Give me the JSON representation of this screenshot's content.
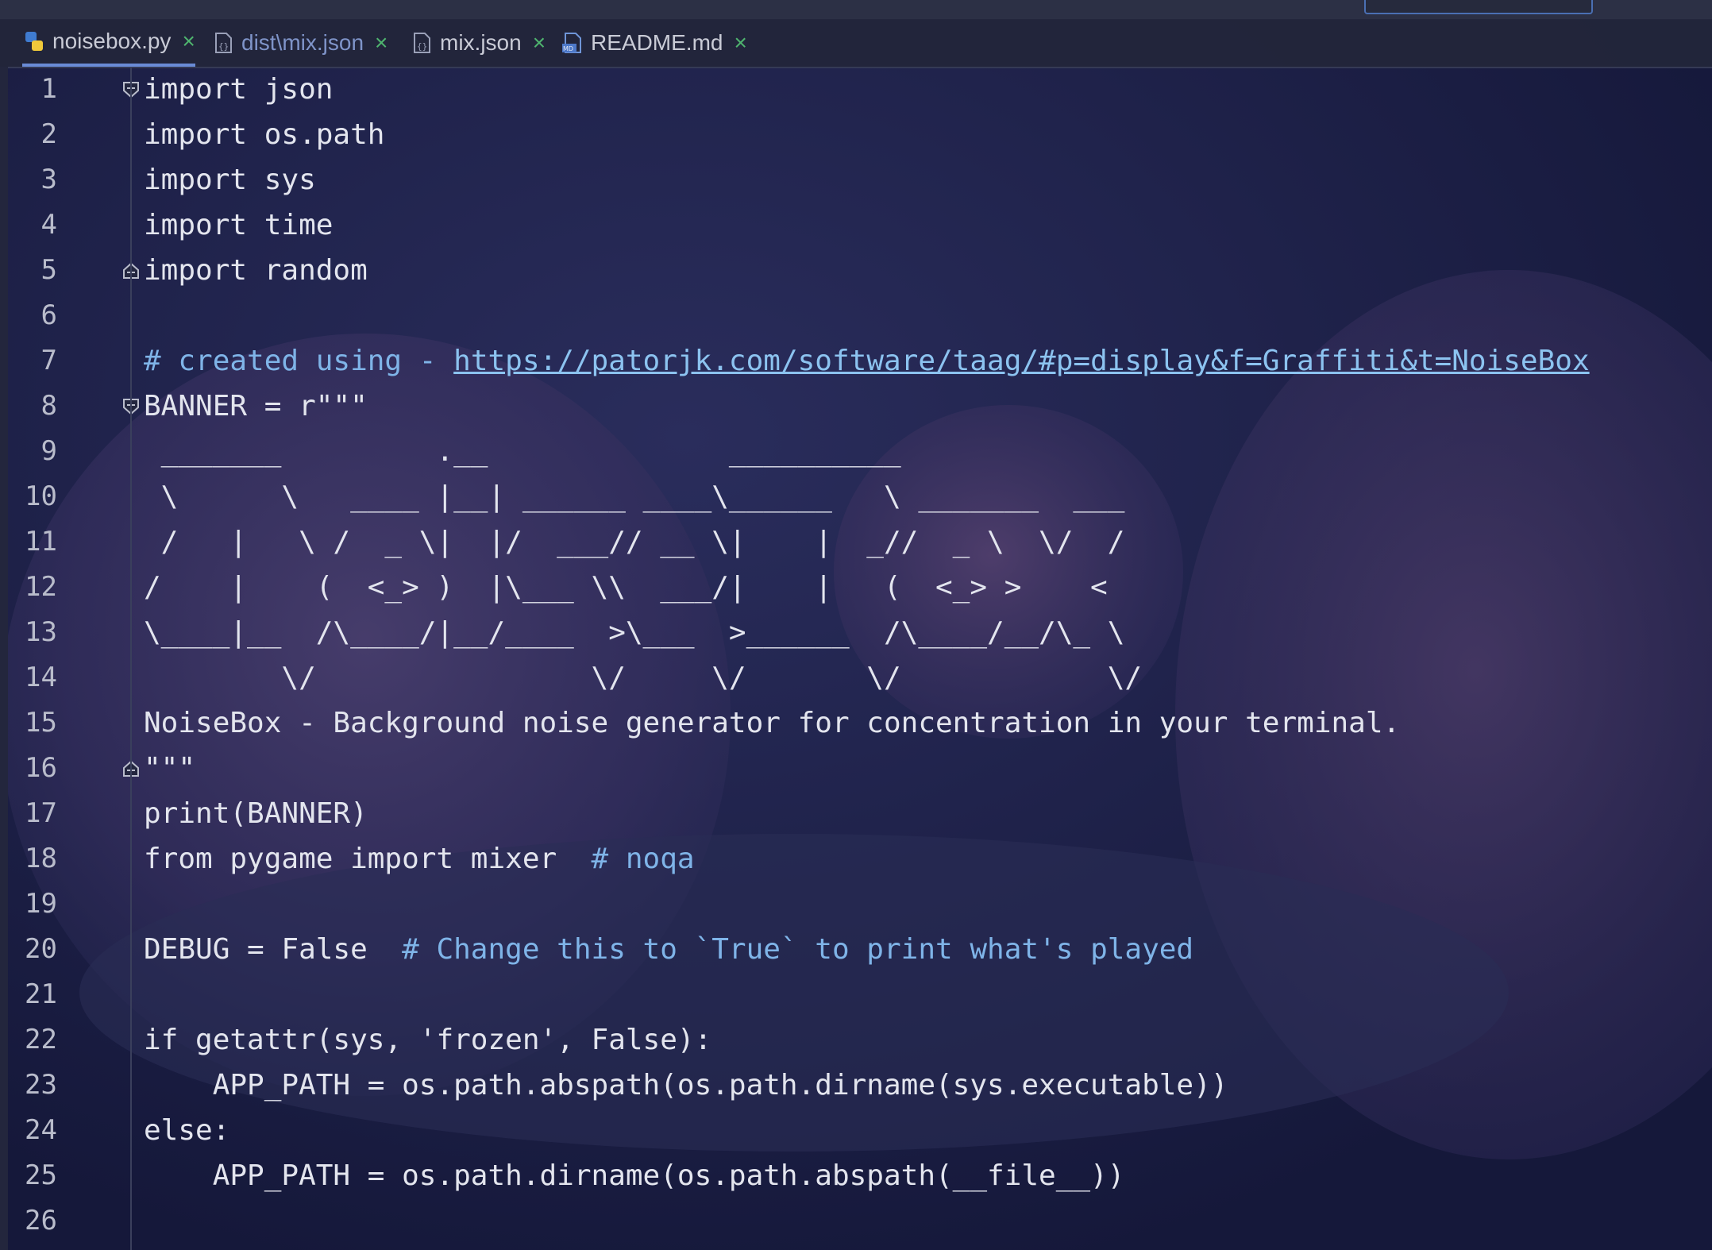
{
  "tabs": [
    {
      "label": "noisebox.py",
      "icon": "python-file-icon",
      "active": true
    },
    {
      "label": "dist\\mix.json",
      "icon": "json-file-icon",
      "modified": true
    },
    {
      "label": "mix.json",
      "icon": "json-file-icon"
    },
    {
      "label": "README.md",
      "icon": "markdown-file-icon"
    }
  ],
  "close_glyph": "×",
  "editor": {
    "lines": [
      {
        "n": "1",
        "code": "import json"
      },
      {
        "n": "2",
        "code": "import os.path"
      },
      {
        "n": "3",
        "code": "import sys"
      },
      {
        "n": "4",
        "code": "import time"
      },
      {
        "n": "5",
        "code": "import random"
      },
      {
        "n": "6",
        "code": ""
      },
      {
        "n": "7",
        "comment": "# created using - ",
        "link": "https://patorjk.com/software/taag/#p=display&f=Graffiti&t=NoiseBox"
      },
      {
        "n": "8",
        "code": "BANNER = r\"\"\""
      },
      {
        "n": "9",
        "code": " _______         .__              __________"
      },
      {
        "n": "10",
        "code": " \\      \\   ____ |__| ______ ____\\______   \\ _______  ___"
      },
      {
        "n": "11",
        "code": " /   |   \\ /  _ \\|  |/  ___// __ \\|    |  _//  _ \\  \\/  /"
      },
      {
        "n": "12",
        "code": "/    |    (  <_> )  |\\___ \\\\  ___/|    |   (  <_> >    <"
      },
      {
        "n": "13",
        "code": "\\____|__  /\\____/|__/____  >\\___  >______  /\\____/__/\\_ \\"
      },
      {
        "n": "14",
        "code": "        \\/                \\/     \\/       \\/            \\/"
      },
      {
        "n": "15",
        "code": "NoiseBox - Background noise generator for concentration in your terminal."
      },
      {
        "n": "16",
        "code": "\"\"\""
      },
      {
        "n": "17",
        "code": "print(BANNER)"
      },
      {
        "n": "18",
        "code": "from pygame import mixer  ",
        "comment": "# noqa"
      },
      {
        "n": "19",
        "code": ""
      },
      {
        "n": "20",
        "code": "DEBUG = False  ",
        "comment": "# Change this to `True` to print what's played"
      },
      {
        "n": "21",
        "code": ""
      },
      {
        "n": "22",
        "code": "if getattr(sys, 'frozen', False):"
      },
      {
        "n": "23",
        "code": "    APP_PATH = os.path.abspath(os.path.dirname(sys.executable))"
      },
      {
        "n": "24",
        "code": "else:"
      },
      {
        "n": "25",
        "code": "    APP_PATH = os.path.dirname(os.path.abspath(__file__))"
      },
      {
        "n": "26",
        "code": ""
      }
    ]
  },
  "colors": {
    "comment": "#7fb4e8",
    "link": "#8cc3f0",
    "code": "#e3e5ee",
    "tab_close": "#4fb56f",
    "active_tab_underline": "#6a8bd6"
  }
}
